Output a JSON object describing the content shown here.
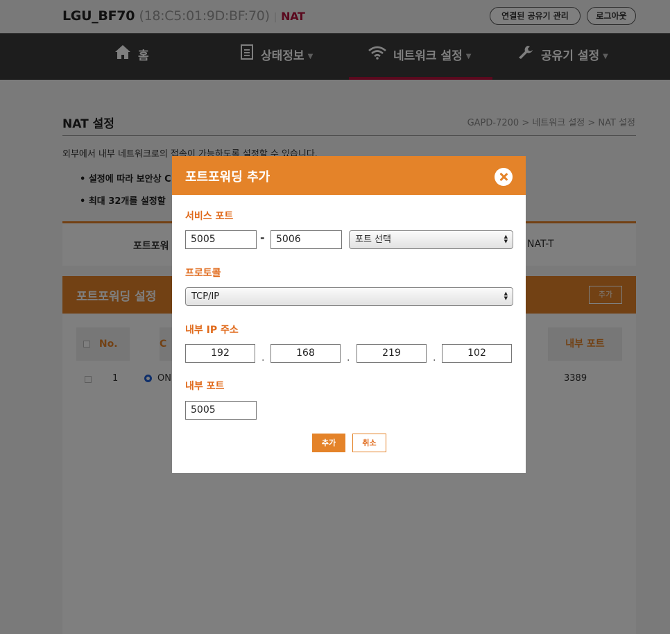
{
  "header": {
    "device_name": "LGU_BF70",
    "mac": "(18:C5:01:9D:BF:70)",
    "separator": "|",
    "mode": "NAT",
    "connected_devices_button": "연결된 공유기 관리",
    "logout_button": "로그아웃"
  },
  "nav": {
    "items": [
      {
        "label": "홈",
        "icon": "home-icon",
        "caret": ""
      },
      {
        "label": "상태정보",
        "icon": "document-icon",
        "caret": "▼"
      },
      {
        "label": "네트워크 설정",
        "icon": "wifi-icon",
        "caret": "▼"
      },
      {
        "label": "공유기 설정",
        "icon": "wrench-icon",
        "caret": "▼"
      }
    ],
    "active_index": 2,
    "active_color": "#b5123c"
  },
  "page": {
    "title": "NAT 설정",
    "breadcrumb": "GAPD-7200 > 네트워크 설정 > NAT 설정",
    "description": "외부에서 내부 네트워크로의 접속이 가능하도록 설정할 수 있습니다.",
    "bullets": [
      "• 설정에 따라 보안상 C",
      "• 최대 32개를 설정할 "
    ]
  },
  "tabs": {
    "left": "포트포워",
    "right": "NAT-T"
  },
  "section": {
    "title": "포트포워딩 설정",
    "add_button": "추가"
  },
  "table": {
    "headers": {
      "no": "No.",
      "c": "C",
      "internal_port": "내부 포트"
    },
    "rows": [
      {
        "no": "1",
        "status": "ON",
        "internal_port": "3389"
      }
    ]
  },
  "modal": {
    "title": "포트포워딩 추가",
    "service_port_label": "서비스 포트",
    "service_port_start": "5005",
    "service_port_dash": "-",
    "service_port_end": "5006",
    "port_select": "포트 선택",
    "protocol_label": "프로토콜",
    "protocol": "TCP/IP",
    "internal_ip_label": "내부 IP 주소",
    "ip": [
      "192",
      "168",
      "219",
      "102"
    ],
    "ip_dot": ".",
    "internal_port_label": "내부 포트",
    "internal_port": "5005",
    "add_button": "추가",
    "cancel_button": "취소"
  },
  "colors": {
    "accent": "#e48329",
    "brand": "#b5123c",
    "nav_bg": "#3a3a3a"
  }
}
